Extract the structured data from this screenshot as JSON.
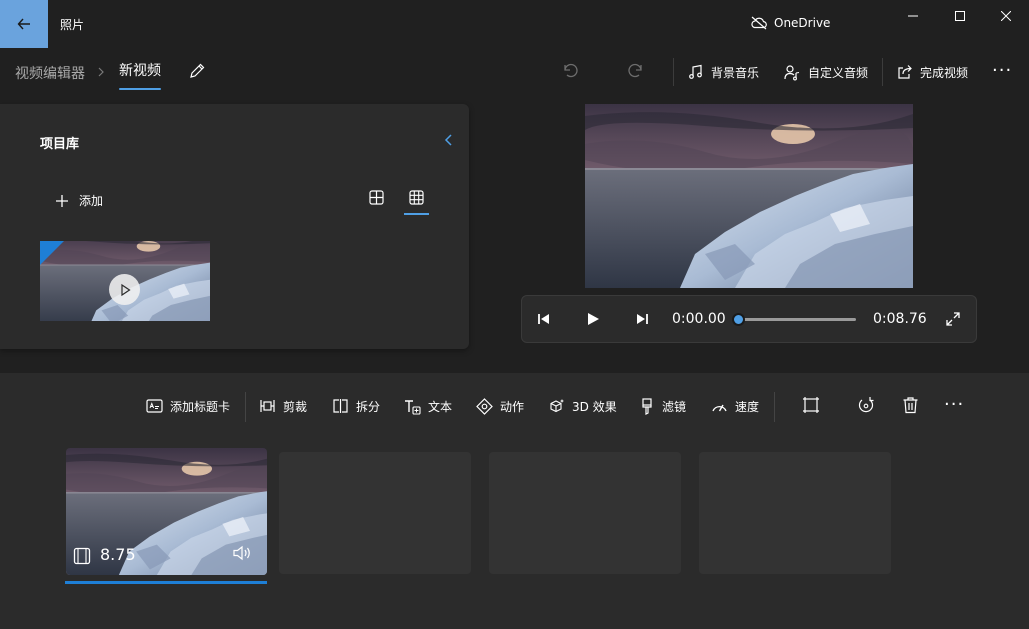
{
  "window": {
    "app_title": "照片",
    "onedrive_label": "OneDrive"
  },
  "commandbar": {
    "breadcrumb_parent": "视频编辑器",
    "breadcrumb_current": "新视频",
    "background_music": "背景音乐",
    "custom_audio": "自定义音频",
    "finish_video": "完成视频",
    "more": "···"
  },
  "library": {
    "title": "项目库",
    "add_label": "添加"
  },
  "player": {
    "current_time": "0:00.00",
    "total_time": "0:08.76",
    "progress": 0
  },
  "storyboard": {
    "tools": [
      {
        "label": "添加标题卡",
        "icon": "title-card-icon"
      },
      {
        "label": "剪裁",
        "icon": "trim-icon"
      },
      {
        "label": "拆分",
        "icon": "split-icon"
      },
      {
        "label": "文本",
        "icon": "text-icon"
      },
      {
        "label": "动作",
        "icon": "motion-icon"
      },
      {
        "label": "3D 效果",
        "icon": "3d-effects-icon"
      },
      {
        "label": "滤镜",
        "icon": "filter-icon"
      },
      {
        "label": "速度",
        "icon": "speed-icon"
      }
    ],
    "more": "···",
    "clip_duration": "8.75"
  },
  "colors": {
    "accent": "#4f9fe5",
    "back_button": "#6aa3dd",
    "selection": "#1e7fd6",
    "background": "#202020",
    "panel": "#2b2b2b"
  }
}
